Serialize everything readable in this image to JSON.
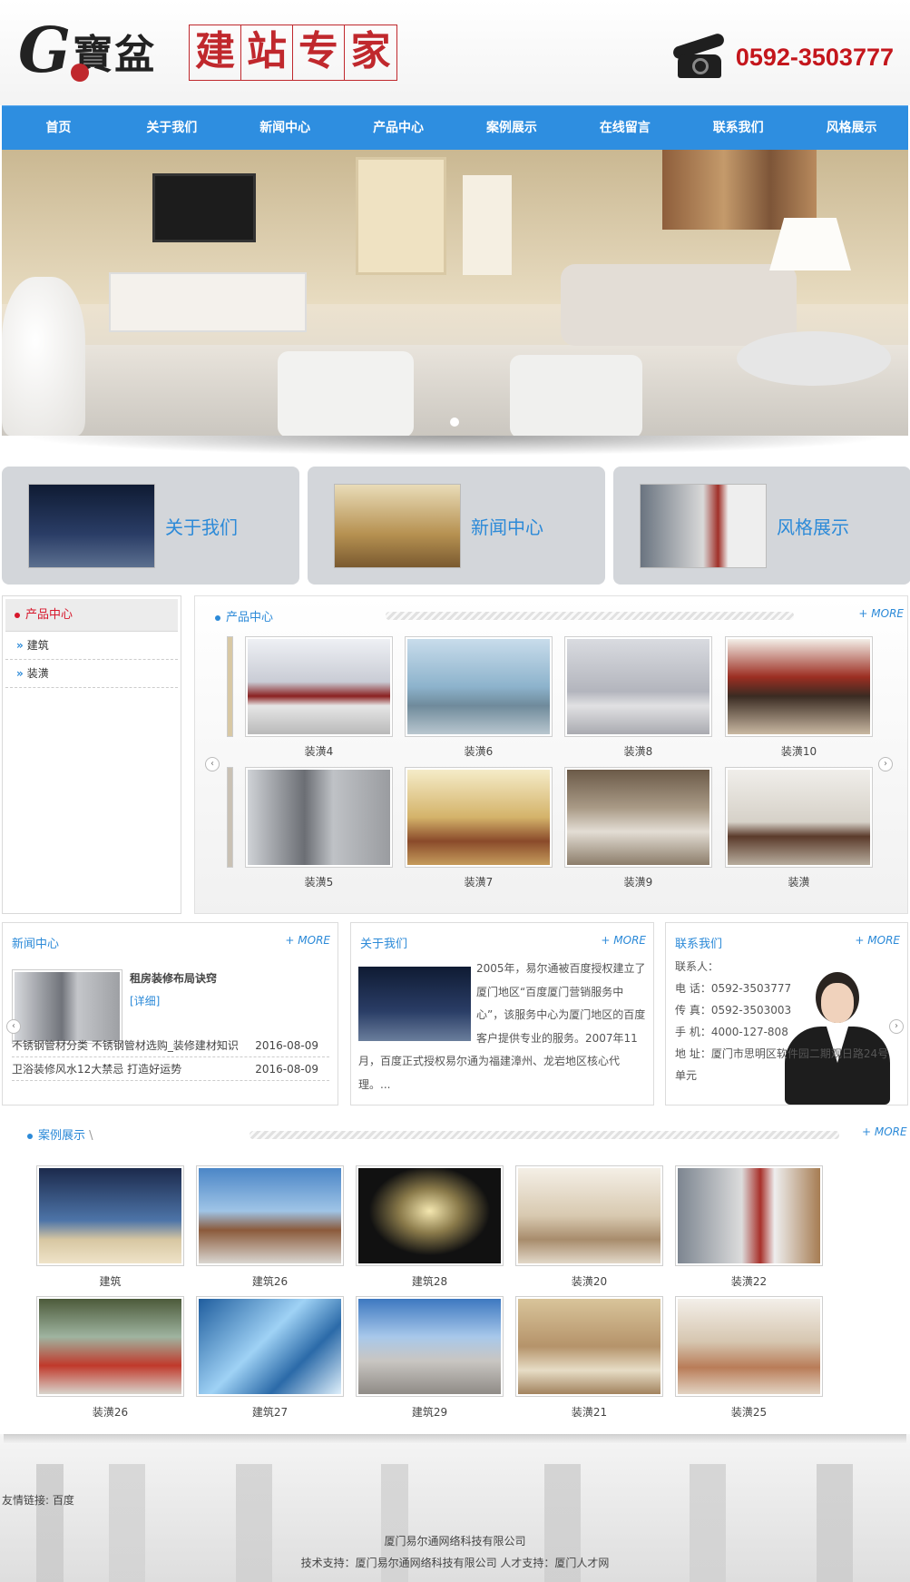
{
  "header": {
    "logo_g": "G",
    "logo_cn": "寶盆",
    "slogan_chars": [
      "建",
      "站",
      "专",
      "家"
    ],
    "phone": "0592-3503777"
  },
  "nav": [
    "首页",
    "关于我们",
    "新闻中心",
    "产品中心",
    "案例展示",
    "在线留言",
    "联系我们",
    "风格展示"
  ],
  "quick": [
    {
      "title": "关于我们",
      "color": "#1b2b4a"
    },
    {
      "title": "新闻中心",
      "color": "#b79a5c"
    },
    {
      "title": "风格展示",
      "color": "#8a8a8a"
    }
  ],
  "sidebar": {
    "title": "产品中心",
    "items": [
      "建筑",
      "装潢"
    ]
  },
  "products": {
    "title": "产品中心",
    "more": "+ MORE",
    "row1": [
      "装潢4",
      "装潢6",
      "装潢8",
      "装潢10"
    ],
    "row2": [
      "装潢5",
      "装潢7",
      "装潢9",
      "装潢"
    ]
  },
  "news": {
    "title": "新闻中心",
    "more": "+ MORE",
    "feature_title": "租房装修布局诀窍",
    "feature_detail": "[详细]",
    "rows": [
      {
        "text": "不锈钢管材分类 不锈钢管材选购_装修建材知识",
        "date": "2016-08-09"
      },
      {
        "text": "卫浴装修风水12大禁忌 打造好运势",
        "date": "2016-08-09"
      }
    ]
  },
  "about": {
    "title": "关于我们",
    "more": "+ MORE",
    "text": "2005年，易尔通被百度授权建立了厦门地区“百度厦门营销服务中心”，该服务中心为厦门地区的百度客户提供专业的服务。2007年11月，百度正式授权易尔通为福建漳州、龙岩地区核心代理。..."
  },
  "contact": {
    "title": "联系我们",
    "more": "+ MORE",
    "lines": [
      "联系人：",
      "电 话：0592-3503777",
      "传 真：0592-3503003",
      "手 机：4000-127-808",
      "地 址：厦门市思明区软件园二期观日路24号",
      "单元"
    ]
  },
  "cases": {
    "title": "案例展示",
    "more": "+ MORE",
    "row1": [
      "建筑",
      "建筑26",
      "建筑28",
      "装潢20",
      "装潢22"
    ],
    "row2": [
      "装潢26",
      "建筑27",
      "建筑29",
      "装潢21",
      "装潢25"
    ]
  },
  "footer": {
    "links": "友情链接: 百度",
    "company": "厦门易尔通网络科技有限公司",
    "support": "技术支持：厦门易尔通网络科技有限公司 人才支持：厦门人才网"
  }
}
